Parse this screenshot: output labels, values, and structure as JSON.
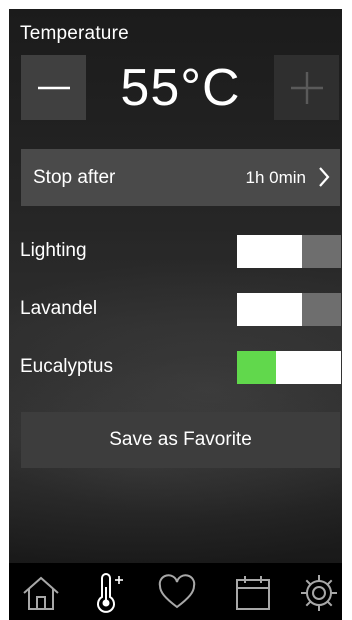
{
  "temperature": {
    "label": "Temperature",
    "value": "55°C",
    "decrease_icon": "minus-icon",
    "increase_icon": "plus-icon"
  },
  "stop_after": {
    "label": "Stop after",
    "value": "1h 0min",
    "chevron_icon": "chevron-right-icon"
  },
  "toggles": [
    {
      "label": "Lighting",
      "state": "off"
    },
    {
      "label": "Lavandel",
      "state": "off"
    },
    {
      "label": "Eucalyptus",
      "state": "on"
    }
  ],
  "favorite": {
    "label": "Save as Favorite"
  },
  "nav": [
    {
      "icon": "home-icon"
    },
    {
      "icon": "thermometer-plus-icon",
      "active": true
    },
    {
      "icon": "heart-icon"
    },
    {
      "icon": "calendar-icon"
    },
    {
      "icon": "gear-icon"
    }
  ],
  "colors": {
    "toggle_on": "#61d84c",
    "toggle_off": "#6e6e6e"
  }
}
